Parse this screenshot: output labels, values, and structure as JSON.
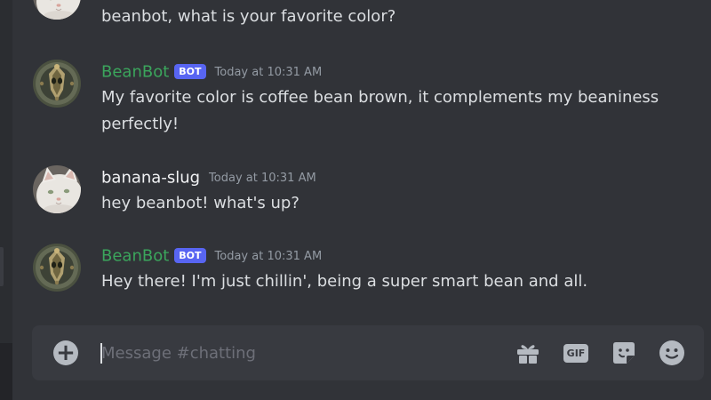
{
  "channel": "chatting",
  "messages": [
    {
      "author": "",
      "is_bot": false,
      "timestamp": "",
      "text": "beanbot, what is your favorite color?",
      "avatar_icon": "white-cat-avatar"
    },
    {
      "author": "BeanBot",
      "is_bot": true,
      "bot_tag": "BOT",
      "timestamp": "Today at 10:31 AM",
      "text": "My favorite color is coffee bean brown, it complements my beaniness perfectly!",
      "avatar_icon": "bean-mask-avatar"
    },
    {
      "author": "banana-slug",
      "is_bot": false,
      "timestamp": "Today at 10:31 AM",
      "text": "hey beanbot! what's up?",
      "avatar_icon": "white-cat-avatar"
    },
    {
      "author": "BeanBot",
      "is_bot": true,
      "bot_tag": "BOT",
      "timestamp": "Today at 10:31 AM",
      "text": "Hey there! I'm just chillin', being a super smart bean and all.",
      "avatar_icon": "bean-mask-avatar"
    }
  ],
  "composer": {
    "placeholder": "Message #chatting",
    "value": "",
    "add_icon": "plus-circle-icon",
    "gift_icon": "gift-icon",
    "gif_label": "GIF",
    "sticker_icon": "sticker-icon",
    "emoji_icon": "emoji-icon"
  },
  "colors": {
    "background": "#313338",
    "composer_bg": "#383a40",
    "bot_name": "#3ba55c",
    "bot_tag_bg": "#5865f2",
    "timestamp": "#949ba4",
    "text": "#dbdee1",
    "icon": "#b5bac1"
  }
}
